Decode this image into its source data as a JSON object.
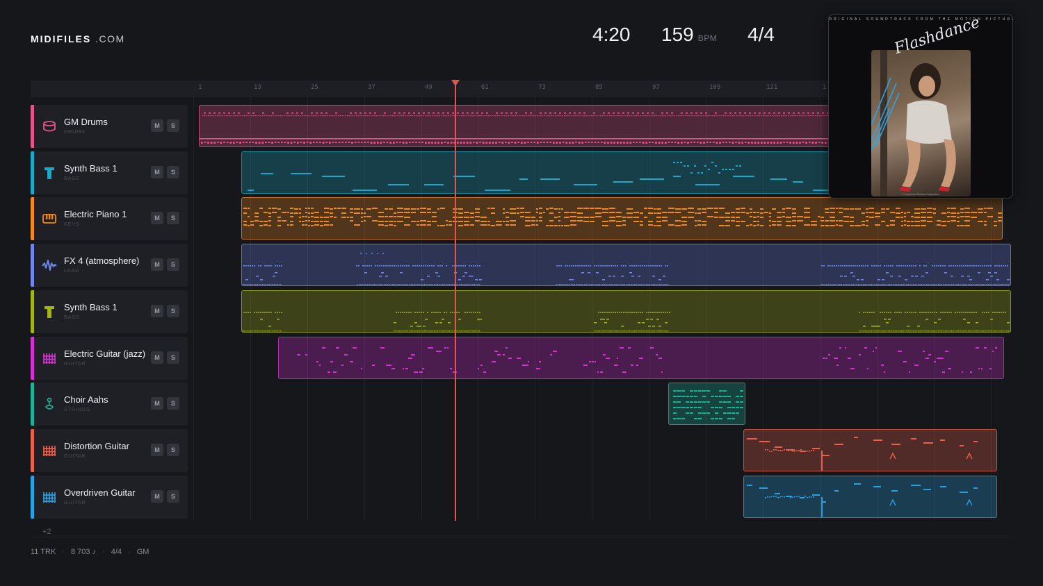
{
  "header": {
    "brand_bold": "MIDIFILES",
    "brand_light": ".COM",
    "time": "4:20",
    "bpm_value": "159",
    "bpm_unit": "BPM",
    "meter": "4/4"
  },
  "ruler": {
    "ticks": [
      "1",
      "13",
      "25",
      "37",
      "49",
      "61",
      "73",
      "85",
      "97",
      "109",
      "121",
      "1"
    ]
  },
  "tracks": [
    {
      "name": "GM Drums",
      "category": "DRUMS",
      "color": "#e2558a",
      "icon": "drum-icon",
      "mute": "M",
      "solo": "S"
    },
    {
      "name": "Synth Bass 1",
      "category": "BASS",
      "color": "#1aa9c7",
      "icon": "bass-icon",
      "mute": "M",
      "solo": "S"
    },
    {
      "name": "Electric Piano 1",
      "category": "KEYS",
      "color": "#f08a1c",
      "icon": "keyboard-icon",
      "mute": "M",
      "solo": "S"
    },
    {
      "name": "FX 4 (atmosphere)",
      "category": "LEAD",
      "color": "#7186ea",
      "icon": "wave-icon",
      "mute": "M",
      "solo": "S"
    },
    {
      "name": "Synth Bass 1",
      "category": "BASS",
      "color": "#a4b512",
      "icon": "bass-icon",
      "mute": "M",
      "solo": "S"
    },
    {
      "name": "Electric Guitar (jazz)",
      "category": "GUITAR",
      "color": "#d62fd3",
      "icon": "guitar-grid-icon",
      "mute": "M",
      "solo": "S"
    },
    {
      "name": "Choir Aahs",
      "category": "STRINGS",
      "color": "#1cb399",
      "icon": "choir-icon",
      "mute": "M",
      "solo": "S"
    },
    {
      "name": "Distortion Guitar",
      "category": "GUITAR",
      "color": "#e9604b",
      "icon": "guitar-grid-icon",
      "mute": "M",
      "solo": "S"
    },
    {
      "name": "Overdriven Guitar",
      "category": "GUITAR",
      "color": "#27a1e3",
      "icon": "guitar-grid-icon",
      "mute": "M",
      "solo": "S"
    }
  ],
  "more_tracks": "+2",
  "footer": {
    "tracks": "11 TRK",
    "notes": "8 703 ♪",
    "meter": "4/4",
    "standard": "GM"
  },
  "album": {
    "top_text": "ORIGINAL SOUNDTRACK FROM THE MOTION PICTURE",
    "title": "Flashdance"
  }
}
